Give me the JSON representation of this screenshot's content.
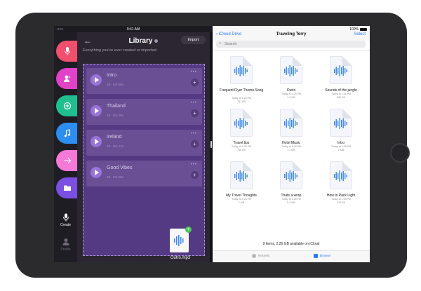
{
  "status_bar": {
    "signal": "••• ",
    "time": "9:41 AM",
    "battery": "100%"
  },
  "library": {
    "back_label": "←",
    "title": "Library",
    "import_label": "Import",
    "subtitle": "Everything you've ever created or imported.",
    "items": [
      {
        "title": "Intro",
        "meta": "2d · 0m 56s"
      },
      {
        "title": "Thailand",
        "meta": "2d · 0m 40s"
      },
      {
        "title": "Ireland",
        "meta": "2d · 0m 41s"
      },
      {
        "title": "Good Vibes",
        "meta": "5d · 0m 56s"
      }
    ],
    "dragged_file": "Outro.mp3"
  },
  "rail": {
    "buttons": [
      {
        "icon": "microphone-icon",
        "color": "#f0506e"
      },
      {
        "icon": "person-voice-icon",
        "color": "#e042c8"
      },
      {
        "icon": "add-circle-icon",
        "color": "#1fbf8f"
      },
      {
        "icon": "music-note-icon",
        "color": "#2b8ef0"
      },
      {
        "icon": "arrow-right-icon",
        "color": "#f57ad8"
      },
      {
        "icon": "folder-icon",
        "color": "#7b4fe0"
      }
    ],
    "create_label": "Create",
    "profile_label": "Profile"
  },
  "files": {
    "back_label": "iCloud Drive",
    "title": "Traveling Terry",
    "select_label": "Select",
    "search_placeholder": "Search",
    "items": [
      {
        "name": "Frequent Flyer Theme Song",
        "date": "Today at 1:28 PM",
        "size": "781 KB"
      },
      {
        "name": "Outro",
        "date": "Today at 1:28 PM",
        "size": "1.2 MB"
      },
      {
        "name": "Sounds of the jungle",
        "date": "Today at 1:28 PM",
        "size": "880 KB"
      },
      {
        "name": "Travel tips",
        "date": "Today at 1:28 PM",
        "size": "746 KB"
      },
      {
        "name": "Hotel Music",
        "date": "Today at 1:28 PM",
        "size": "1.2 MB"
      },
      {
        "name": "Intro",
        "date": "Today at 1:28 PM",
        "size": "2 MB"
      },
      {
        "name": "My Travel Thoughts",
        "date": "Today at 1:28 PM",
        "size": "7 MB"
      },
      {
        "name": "Thats a wrap",
        "date": "Today at 1:28 PM",
        "size": "8.4 MB"
      },
      {
        "name": "How to Pack Light",
        "date": "Today at 1:28 PM",
        "size": "376 KB"
      }
    ],
    "footer": "9 items, 2.26 GB available on iCloud",
    "tabs": {
      "recents": "Recents",
      "browse": "Browse"
    }
  },
  "colors": {
    "accent": "#2b7cf6",
    "waveform": "#3b86f0",
    "dropzone": "#543a82"
  }
}
